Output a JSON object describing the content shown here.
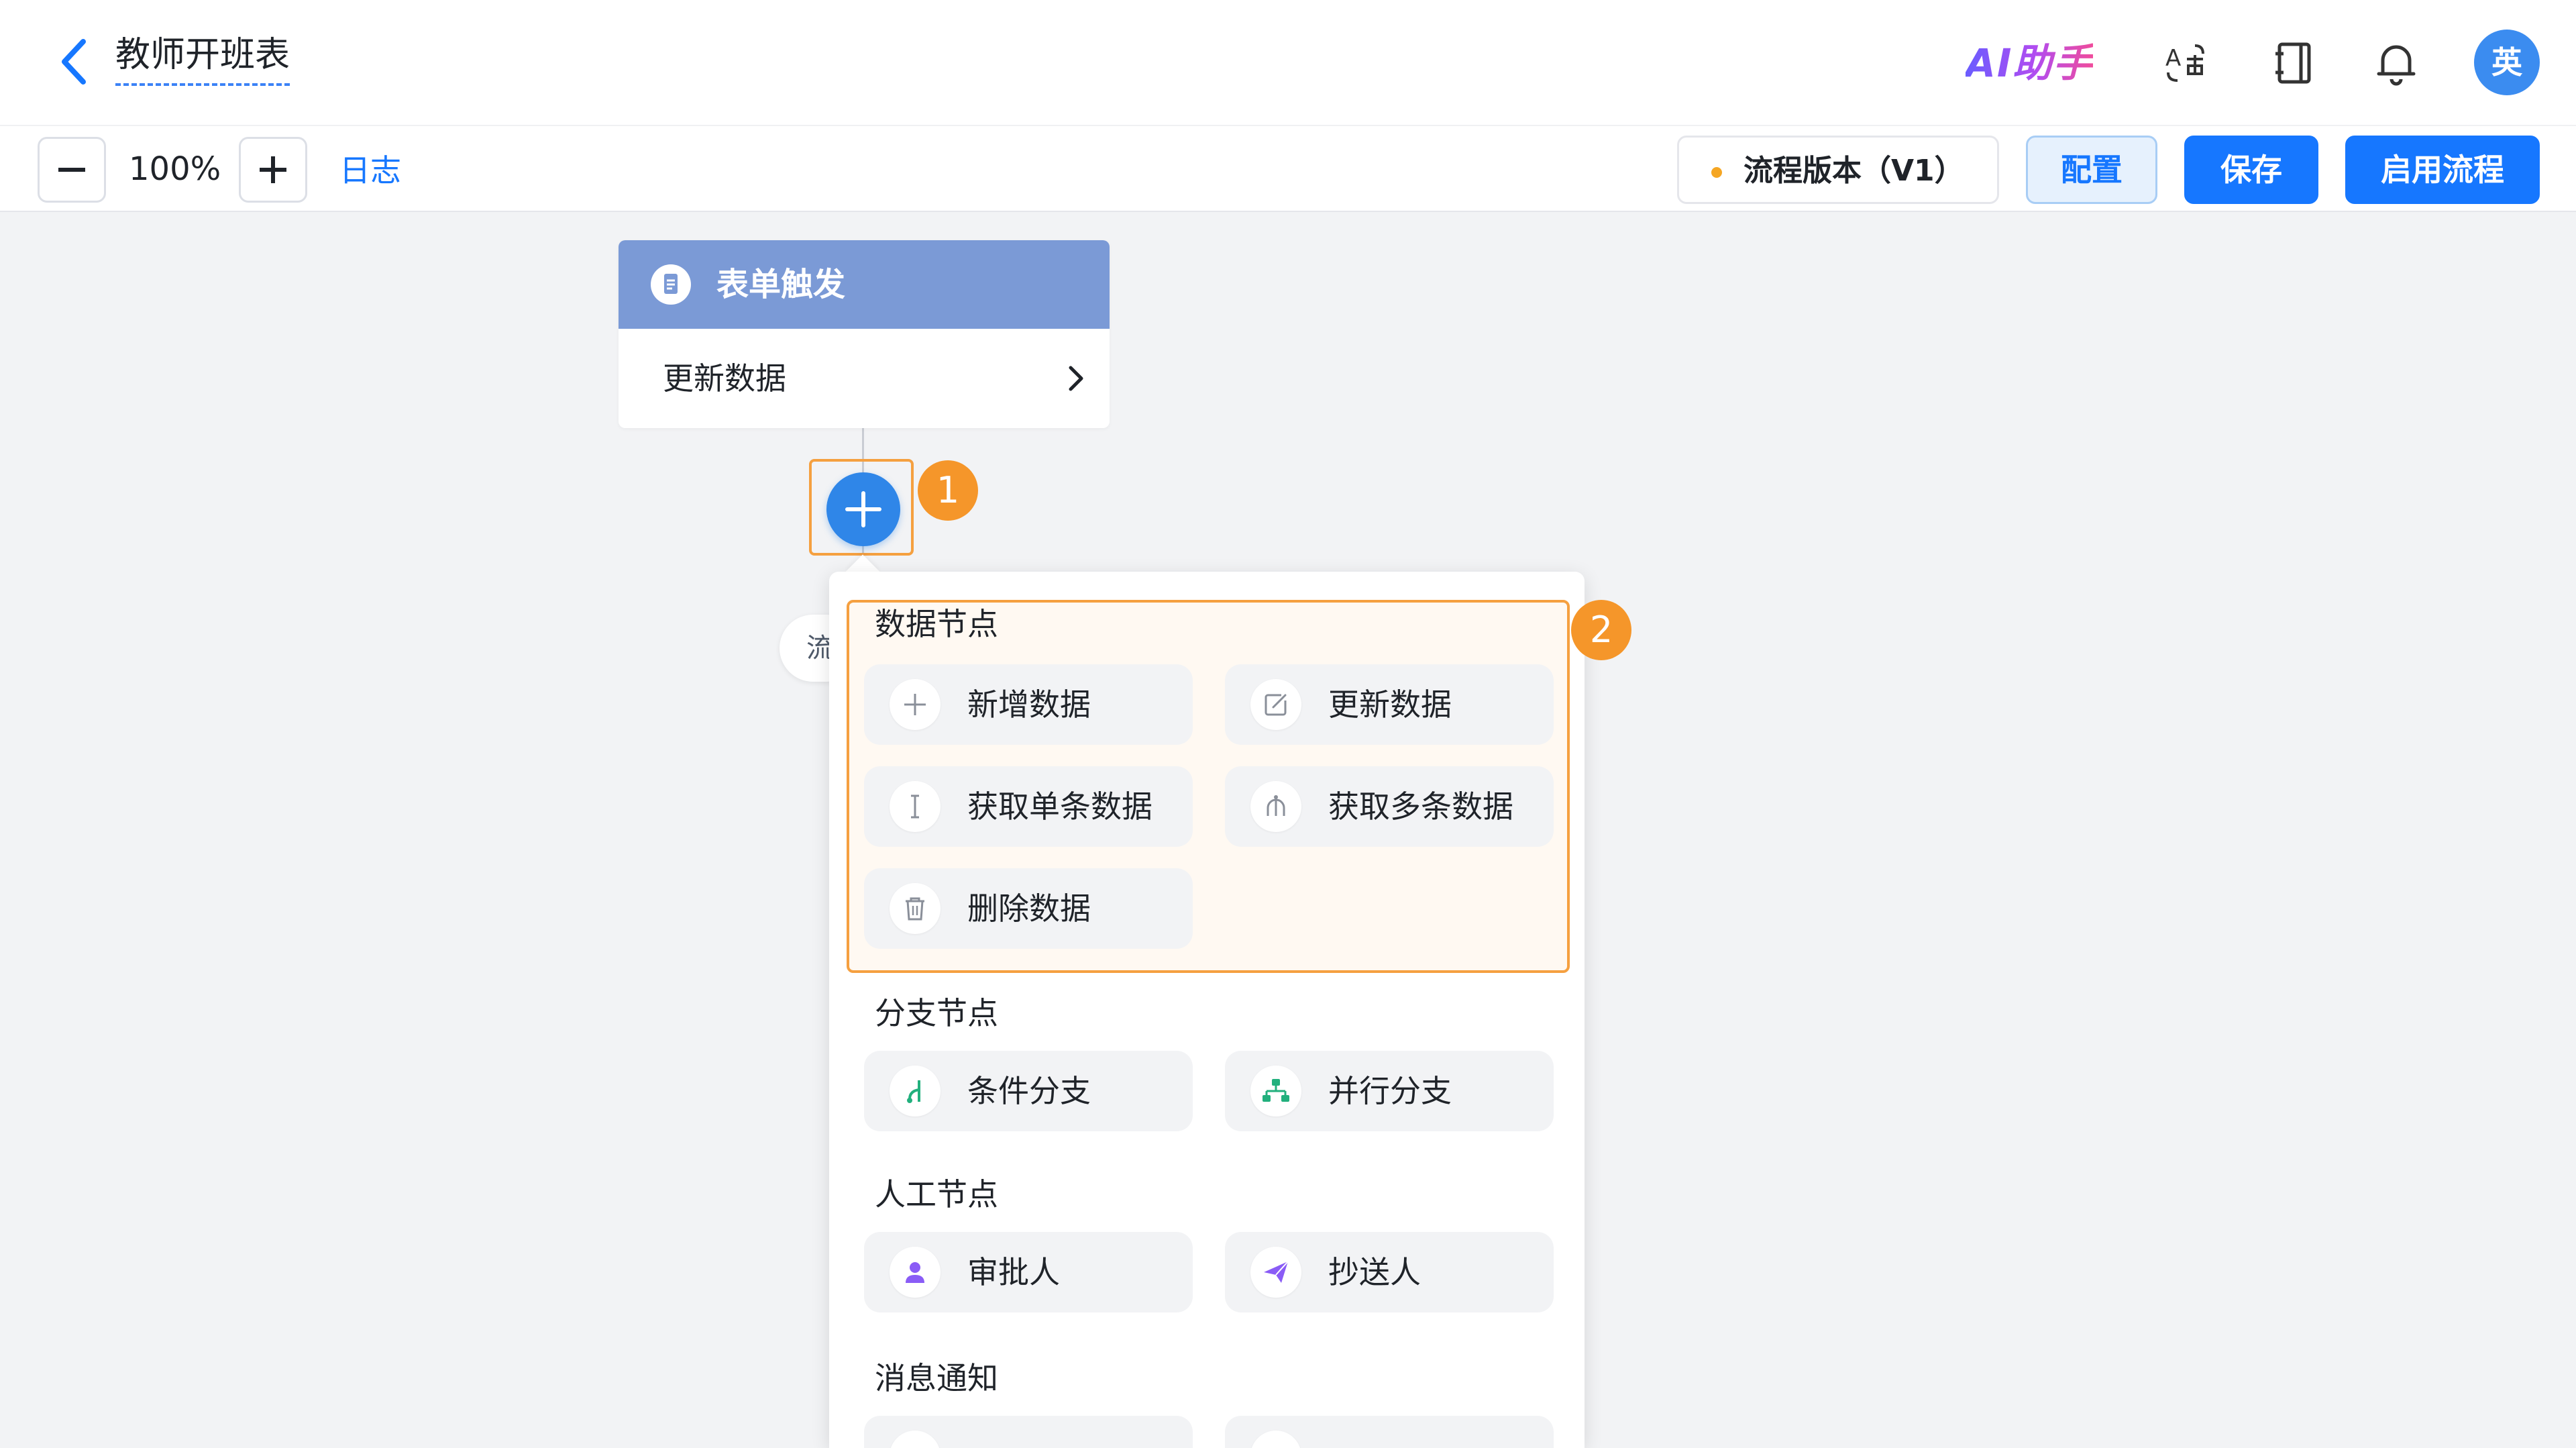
{
  "header": {
    "title": "教师开班表",
    "ai_assistant": "AI助手",
    "avatar_text": "英"
  },
  "toolbar": {
    "zoom_level": "100%",
    "log_link": "日志",
    "version_label": "流程版本（V1）",
    "config_button": "配置",
    "save_button": "保存",
    "enable_button": "启用流程"
  },
  "canvas": {
    "trigger": {
      "title": "表单触发",
      "action": "更新数据"
    },
    "badges": [
      "1",
      "2"
    ],
    "hidden_pill_text": "流"
  },
  "menu": {
    "sections": [
      {
        "title": "数据节点",
        "items": [
          {
            "label": "新增数据",
            "icon": "plus-icon"
          },
          {
            "label": "更新数据",
            "icon": "edit-icon"
          },
          {
            "label": "获取单条数据",
            "icon": "single-data-icon"
          },
          {
            "label": "获取多条数据",
            "icon": "multi-data-icon"
          },
          {
            "label": "删除数据",
            "icon": "trash-icon"
          }
        ]
      },
      {
        "title": "分支节点",
        "items": [
          {
            "label": "条件分支",
            "icon": "condition-branch-icon"
          },
          {
            "label": "并行分支",
            "icon": "parallel-branch-icon"
          }
        ]
      },
      {
        "title": "人工节点",
        "items": [
          {
            "label": "审批人",
            "icon": "approver-icon"
          },
          {
            "label": "抄送人",
            "icon": "cc-send-icon"
          }
        ]
      },
      {
        "title": "消息通知",
        "items": []
      }
    ]
  },
  "colors": {
    "primary": "#1677ff",
    "trigger_header": "#7b9ad6",
    "highlight": "#f5a040",
    "badge": "#f5962a",
    "branch_icon": "#22b07d",
    "human_icon": "#8a5cf6"
  }
}
